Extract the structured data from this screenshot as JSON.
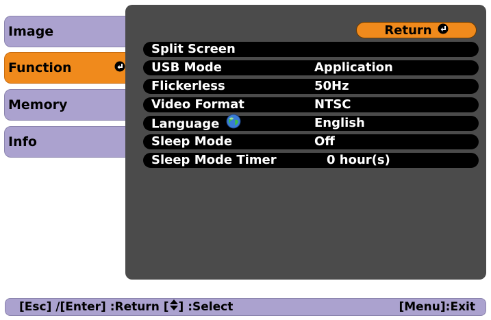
{
  "menu": {
    "tabs": [
      {
        "label": "Image"
      },
      {
        "label": "Function"
      },
      {
        "label": "Memory"
      },
      {
        "label": "Info"
      }
    ],
    "active": "Function"
  },
  "panel": {
    "return_label": "Return",
    "rows": [
      {
        "label": "Split Screen",
        "value": ""
      },
      {
        "label": "USB Mode",
        "value": "Application"
      },
      {
        "label": "Flickerless",
        "value": "50Hz"
      },
      {
        "label": "Video Format",
        "value": "NTSC"
      },
      {
        "label": "Language",
        "value": "English",
        "icon": "globe-icon"
      },
      {
        "label": "Sleep Mode",
        "value": "Off"
      },
      {
        "label": "Sleep Mode Timer",
        "value": "0 hour(s)"
      }
    ]
  },
  "help": {
    "left_prefix": "[Esc] /[Enter] :Return  [",
    "left_suffix": "] :Select",
    "right": "[Menu]:Exit"
  },
  "colors": {
    "tab": "#aba2cf",
    "active_tab": "#f08a1c",
    "panel": "#4b4b4b",
    "row": "#000000"
  }
}
